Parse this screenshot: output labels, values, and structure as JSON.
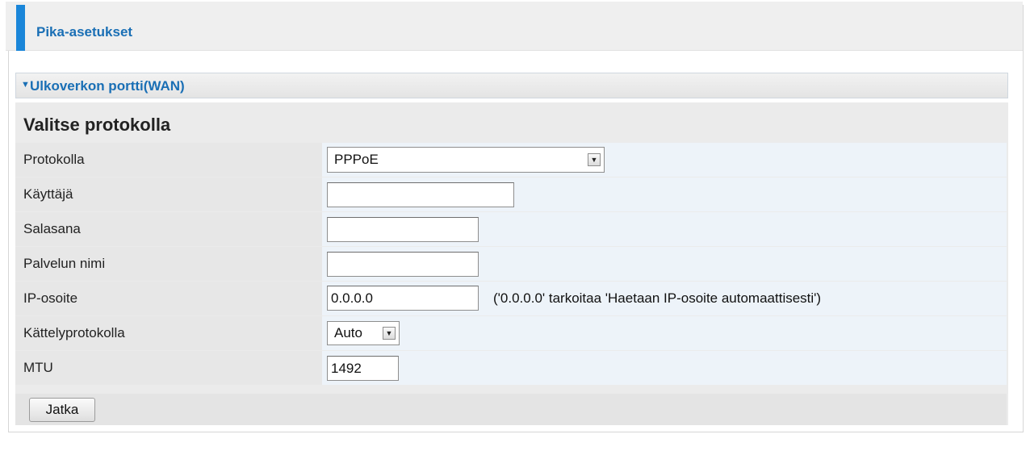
{
  "header": {
    "title": "Pika-asetukset"
  },
  "section": {
    "title": "Ulkoverkon portti(WAN)",
    "arrow_icon": "triangle-down-icon"
  },
  "panel": {
    "title": "Valitse protokolla"
  },
  "fields": {
    "protocol": {
      "label": "Protokolla",
      "value": "PPPoE"
    },
    "user": {
      "label": "Käyttäjä",
      "value": ""
    },
    "password": {
      "label": "Salasana",
      "value": ""
    },
    "service_name": {
      "label": "Palvelun nimi",
      "value": ""
    },
    "ip_address": {
      "label": "IP-osoite",
      "value": "0.0.0.0",
      "hint": "('0.0.0.0' tarkoitaa 'Haetaan IP-osoite automaattisesti')"
    },
    "auth_protocol": {
      "label": "Kättelyprotokolla",
      "value": "Auto"
    },
    "mtu": {
      "label": "MTU",
      "value": "1492"
    }
  },
  "actions": {
    "continue_label": "Jatka"
  },
  "colors": {
    "accent": "#1a86d9",
    "link_text": "#1a6fb5",
    "value_cell_bg": "#edf3f9",
    "label_cell_bg": "#e7e7e7"
  }
}
